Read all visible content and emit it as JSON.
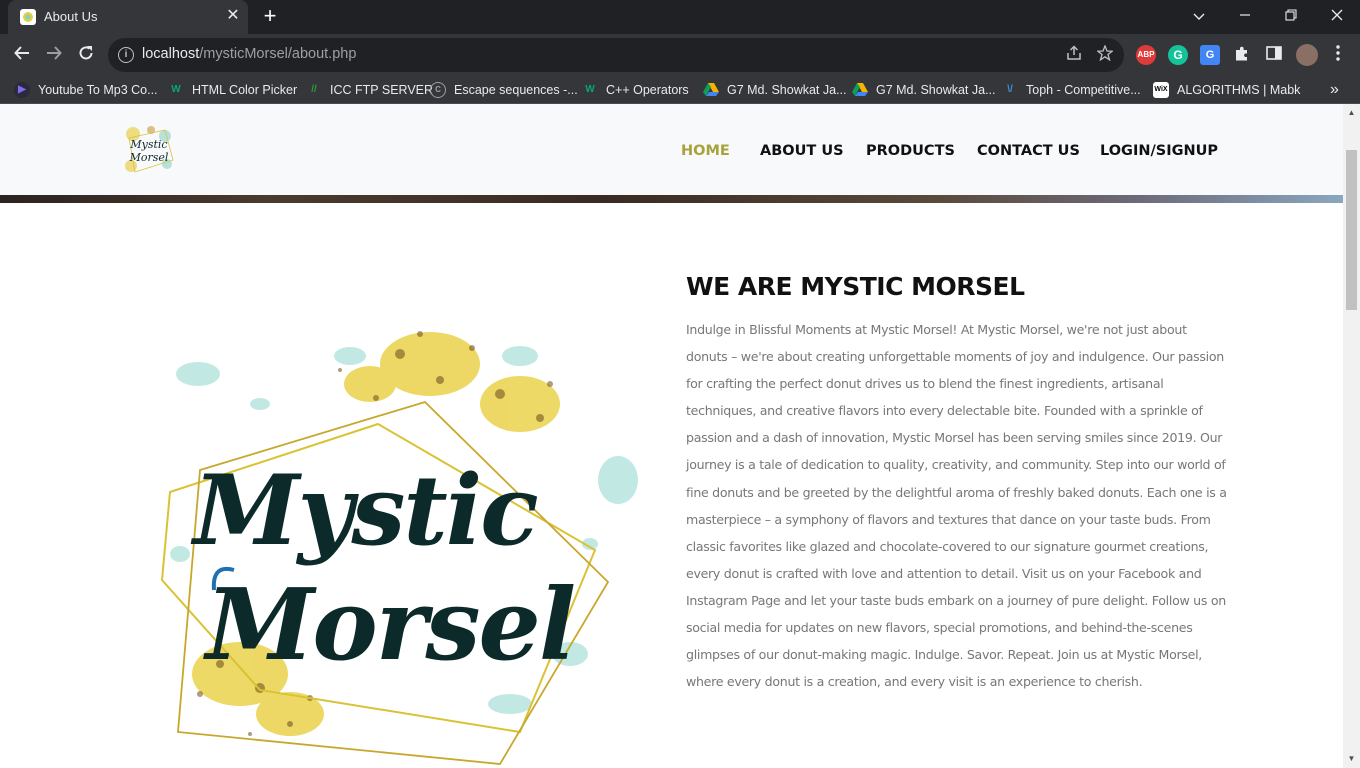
{
  "browser": {
    "tab_title": "About Us",
    "tab_close": "✕",
    "new_tab": "+",
    "url_host": "localhost",
    "url_path": "/mysticMorsel/about.php",
    "bookmarks": [
      {
        "label": "Youtube To Mp3 Co...",
        "icon": "youtube-mp3-icon",
        "color": "#5b3fd6"
      },
      {
        "label": "HTML Color Picker",
        "icon": "w3schools-icon",
        "color": "#04aa6d"
      },
      {
        "label": "ICC FTP SERVER",
        "icon": "icc-ftp-icon",
        "color": "#2e9b3b"
      },
      {
        "label": "Escape sequences -...",
        "icon": "cplusplus-icon",
        "color": "#9aa0a6"
      },
      {
        "label": "C++ Operators",
        "icon": "w3schools-icon",
        "color": "#04aa6d"
      },
      {
        "label": "G7 Md. Showkat Ja...",
        "icon": "google-drive-icon",
        "color": "#f4b400"
      },
      {
        "label": "G7 Md. Showkat Ja...",
        "icon": "google-drive-icon",
        "color": "#f4b400"
      },
      {
        "label": "Toph - Competitive...",
        "icon": "toph-icon",
        "color": "#3b8fd6"
      },
      {
        "label": "ALGORITHMS | Mabk",
        "icon": "wix-icon",
        "color": "#ffffff"
      }
    ],
    "bookmarks_more": "»"
  },
  "site": {
    "nav": [
      "HOME",
      "ABOUT US",
      "PRODUCTS",
      "CONTACT US",
      "LOGIN/SIGNUP"
    ],
    "active_color": "#a8a23a",
    "logo_text": [
      "Mystic",
      "Morsel"
    ]
  },
  "about": {
    "title": "WE ARE MYSTIC MORSEL",
    "text": "Indulge in Blissful Moments at Mystic Morsel! At Mystic Morsel, we're not just about donuts – we're about creating unforgettable moments of joy and indulgence. Our passion for crafting the perfect donut drives us to blend the finest ingredients, artisanal techniques, and creative flavors into every delectable bite. Founded with a sprinkle of passion and a dash of innovation, Mystic Morsel has been serving smiles since 2019. Our journey is a tale of dedication to quality, creativity, and community. Step into our world of fine donuts and be greeted by the delightful aroma of freshly baked donuts. Each one is a masterpiece – a symphony of flavors and textures that dance on your taste buds. From classic favorites like glazed and chocolate-covered to our signature gourmet creations, every donut is crafted with love and attention to detail. Visit us on your Facebook and Instagram Page and let your taste buds embark on a journey of pure delight. Follow us on social media for updates on new flavors, special promotions, and behind-the-scenes glimpses of our donut-making magic. Indulge. Savor. Repeat. Join us at Mystic Morsel, where every donut is a creation, and every visit is an experience to cherish."
  }
}
